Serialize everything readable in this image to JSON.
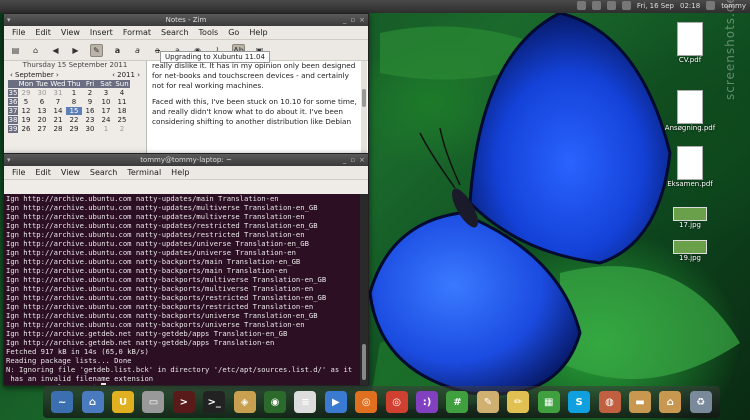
{
  "top_panel": {
    "date": "Fri, 16 Sep",
    "time": "02:18",
    "user": "tommy",
    "icons": [
      "mail-icon",
      "network-icon",
      "volume-icon",
      "battery-icon",
      "bluetooth-icon"
    ]
  },
  "zim": {
    "title": "Notes - Zim",
    "menu": [
      "File",
      "Edit",
      "View",
      "Insert",
      "Format",
      "Search",
      "Tools",
      "Go",
      "Help"
    ],
    "toolbar_icons": [
      "new-page-icon",
      "home-icon",
      "back-icon",
      "forward-icon",
      "link-tool-icon",
      "bold-icon",
      "italic-icon",
      "strike-icon",
      "underline-icon",
      "view-icon",
      "attach-icon",
      "ab-icon",
      "clipboard-icon"
    ],
    "calendar": {
      "date_label": "Thursday 15 September 2011",
      "month": "September",
      "year": "2011",
      "weekdays": [
        "Mon",
        "Tue",
        "Wed",
        "Thu",
        "Fri",
        "Sat",
        "Sun"
      ],
      "weeks": [
        {
          "wk": "35",
          "days": [
            "29",
            "30",
            "31",
            "1",
            "2",
            "3",
            "4"
          ]
        },
        {
          "wk": "36",
          "days": [
            "5",
            "6",
            "7",
            "8",
            "9",
            "10",
            "11"
          ]
        },
        {
          "wk": "37",
          "days": [
            "12",
            "13",
            "14",
            "15",
            "16",
            "17",
            "18"
          ]
        },
        {
          "wk": "38",
          "days": [
            "19",
            "20",
            "21",
            "22",
            "23",
            "24",
            "25"
          ]
        },
        {
          "wk": "39",
          "days": [
            "26",
            "27",
            "28",
            "29",
            "30",
            "1",
            "2"
          ]
        }
      ],
      "selected": "15"
    },
    "page_tab": "Upgrading to Xubuntu 11.04",
    "paragraphs": [
      "really dislike it. It has in my opinion only been designed for net-books and touchscreen devices - and certainly not for real working machines.",
      "Faced with this, I've been stuck on 10.10 for some time, and really didn't know what to do about it. I've been considering shifting to another distribution like Debian"
    ]
  },
  "terminal": {
    "title": "tommy@tommy-laptop: ~",
    "menu": [
      "File",
      "Edit",
      "View",
      "Search",
      "Terminal",
      "Help"
    ],
    "lines": [
      "Ign http://archive.ubuntu.com natty-updates/main Translation-en",
      "Ign http://archive.ubuntu.com natty-updates/multiverse Translation-en_GB",
      "Ign http://archive.ubuntu.com natty-updates/multiverse Translation-en",
      "Ign http://archive.ubuntu.com natty-updates/restricted Translation-en_GB",
      "Ign http://archive.ubuntu.com natty-updates/restricted Translation-en",
      "Ign http://archive.ubuntu.com natty-updates/universe Translation-en_GB",
      "Ign http://archive.ubuntu.com natty-updates/universe Translation-en",
      "Ign http://archive.ubuntu.com natty-backports/main Translation-en_GB",
      "Ign http://archive.ubuntu.com natty-backports/main Translation-en",
      "Ign http://archive.ubuntu.com natty-backports/multiverse Translation-en_GB",
      "Ign http://archive.ubuntu.com natty-backports/multiverse Translation-en",
      "Ign http://archive.ubuntu.com natty-backports/restricted Translation-en_GB",
      "Ign http://archive.ubuntu.com natty-backports/restricted Translation-en",
      "Ign http://archive.ubuntu.com natty-backports/universe Translation-en_GB",
      "Ign http://archive.ubuntu.com natty-backports/universe Translation-en",
      "Ign http://archive.getdeb.net natty-getdeb/apps Translation-en_GB",
      "Ign http://archive.getdeb.net natty-getdeb/apps Translation-en",
      "Fetched 917 kB in 14s (65,0 kB/s)",
      "Reading package lists... Done",
      "N: Ignoring file 'getdeb.list.bck' in directory '/etc/apt/sources.list.d/' as it",
      " has an invalid filename extension"
    ],
    "prompt": "tommy@tommy-laptop:~$ "
  },
  "desktop_icons": [
    {
      "label": "CV.pdf",
      "kind": "doc"
    },
    {
      "label": "Ansøgning.pdf",
      "kind": "doc"
    },
    {
      "label": "Eksamen.pdf",
      "kind": "doc"
    },
    {
      "label": "17.jpg",
      "kind": "img"
    },
    {
      "label": "19.jpg",
      "kind": "img"
    }
  ],
  "watermark": "screenshots.debian.net",
  "dock": [
    {
      "name": "system-monitor-icon",
      "glyph": "~",
      "color": "#3b6fb0"
    },
    {
      "name": "network-manager-icon",
      "glyph": "⌂",
      "color": "#4a7bc0"
    },
    {
      "name": "horseshoe-icon",
      "glyph": "U",
      "color": "#e0b020"
    },
    {
      "name": "printer-icon",
      "glyph": "▭",
      "color": "#999999"
    },
    {
      "name": "terminal-red-icon",
      "glyph": ">",
      "color": "#5a1a1a"
    },
    {
      "name": "terminal-icon",
      "glyph": ">_",
      "color": "#222222"
    },
    {
      "name": "image-viewer-icon",
      "glyph": "◈",
      "color": "#c8a050"
    },
    {
      "name": "globe-icon",
      "glyph": "◉",
      "color": "#2a6a2a"
    },
    {
      "name": "text-editor-icon",
      "glyph": "≡",
      "color": "#dddddd"
    },
    {
      "name": "video-player-icon",
      "glyph": "▶",
      "color": "#3a7ad0"
    },
    {
      "name": "firefox-icon",
      "glyph": "◎",
      "color": "#e07020"
    },
    {
      "name": "chrome-icon",
      "glyph": "◎",
      "color": "#d04030"
    },
    {
      "name": "empathy-icon",
      "glyph": ":)",
      "color": "#8040c0"
    },
    {
      "name": "hash-icon",
      "glyph": "#",
      "color": "#40a040"
    },
    {
      "name": "notes-icon",
      "glyph": "✎",
      "color": "#d0b070"
    },
    {
      "name": "pencil-icon",
      "glyph": "✏",
      "color": "#e0c050"
    },
    {
      "name": "spreadsheet-icon",
      "glyph": "▦",
      "color": "#40a040"
    },
    {
      "name": "skype-icon",
      "glyph": "S",
      "color": "#10a0e0"
    },
    {
      "name": "speaker-icon",
      "glyph": "◍",
      "color": "#c06040"
    },
    {
      "name": "folder-icon",
      "glyph": "▬",
      "color": "#c89850"
    },
    {
      "name": "home-folder-icon",
      "glyph": "⌂",
      "color": "#c89850"
    },
    {
      "name": "trash-icon",
      "glyph": "♻",
      "color": "#7a8a9a"
    }
  ]
}
